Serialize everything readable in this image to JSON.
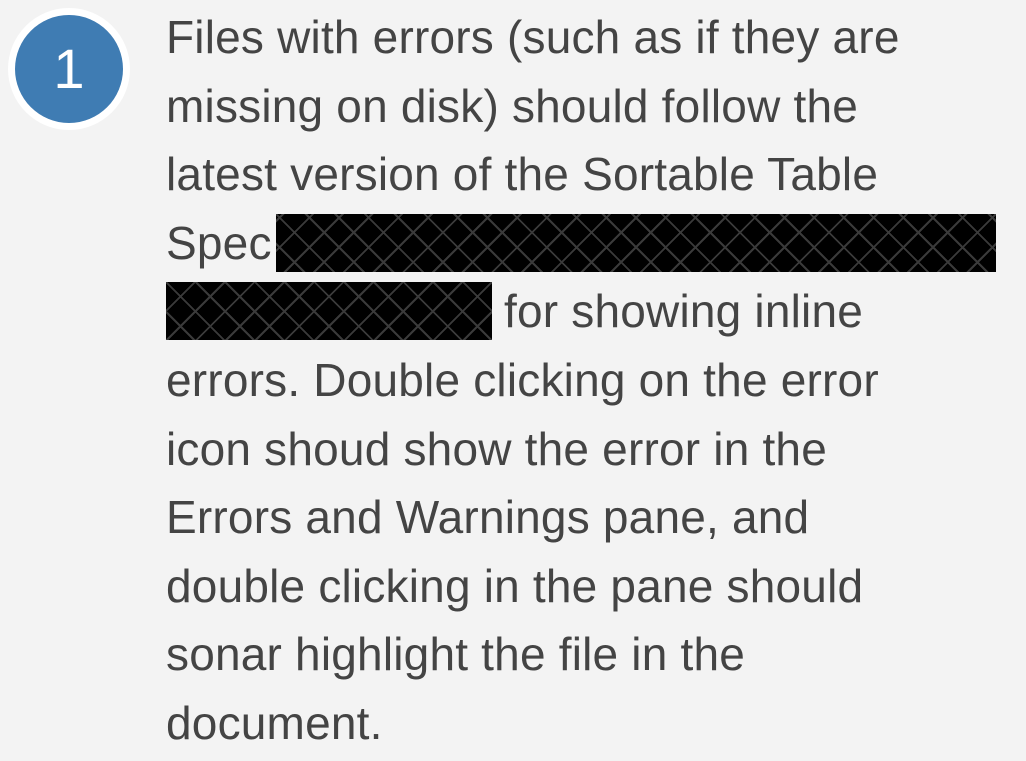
{
  "badge": {
    "number": "1"
  },
  "note": {
    "line1": "Files with errors (such as if they are",
    "line2": "missing on disk) should follow the",
    "line3": "latest version of the Sortable Table",
    "line4_text": "Spec",
    "line5_text": "for showing inline",
    "line6": "errors. Double clicking on the error",
    "line7": "icon shoud show the error in the",
    "line8": "Errors and Warnings pane, and",
    "line9": "double clicking in the pane should",
    "line10": "sonar highlight the file in the",
    "line11": "document."
  },
  "colors": {
    "background": "#f3f3f3",
    "badge_fill": "#3f7cb3",
    "text": "#444444",
    "redaction": "#000000"
  }
}
